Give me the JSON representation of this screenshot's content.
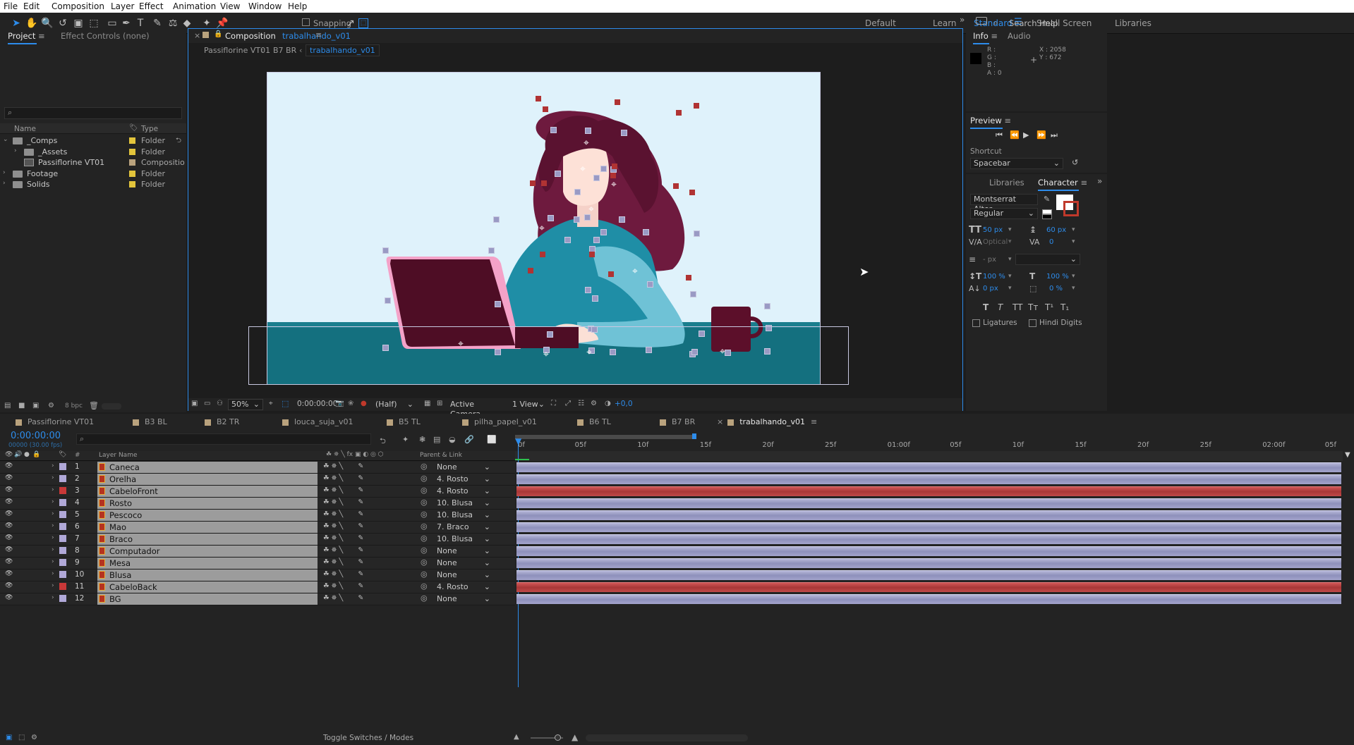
{
  "menu": [
    "File",
    "Edit",
    "Composition",
    "Layer",
    "Effect",
    "Animation",
    "View",
    "Window",
    "Help"
  ],
  "toolbar": {
    "snapping": "Snapping",
    "workspaces": [
      "Default",
      "Learn",
      "Standard",
      "Small Screen",
      "Libraries"
    ],
    "active_workspace": "Standard",
    "search_placeholder": "Search Help"
  },
  "project": {
    "tab": "Project",
    "effect_controls": "Effect Controls (none)",
    "search_placeholder": "",
    "col_name": "Name",
    "col_type": "Type",
    "items": [
      {
        "name": "_Comps",
        "type": "Folder",
        "indent": 0,
        "expanded": true,
        "kind": "folder"
      },
      {
        "name": "_Assets",
        "type": "Folder",
        "indent": 1,
        "expanded": false,
        "kind": "folder"
      },
      {
        "name": "Passiflorine VT01",
        "type": "Compositio",
        "indent": 1,
        "expanded": null,
        "kind": "comp"
      },
      {
        "name": "Footage",
        "type": "Folder",
        "indent": 0,
        "expanded": false,
        "kind": "folder"
      },
      {
        "name": "Solids",
        "type": "Folder",
        "indent": 0,
        "expanded": false,
        "kind": "folder"
      }
    ],
    "bpc": "8 bpc"
  },
  "comp": {
    "tab_prefix": "Composition",
    "tab_name": "trabalhando_v01",
    "breadcrumbs": [
      "Passiflorine VT01",
      "B7 BR",
      "trabalhando_v01"
    ],
    "zoom": "50%",
    "timecode": "0:00:00:00",
    "resolution": "(Half)",
    "camera": "Active Camera",
    "view": "1 View",
    "exposure": "+0,0"
  },
  "info": {
    "tab": "Info",
    "audio_tab": "Audio",
    "r": "R :",
    "g": "G :",
    "b": "B :",
    "a": "A : 0",
    "x": "X : 2058",
    "y": "Y : 672"
  },
  "preview": {
    "title": "Preview",
    "shortcut_label": "Shortcut",
    "shortcut_value": "Spacebar"
  },
  "character": {
    "libraries_tab": "Libraries",
    "tab": "Character",
    "font": "Montserrat Alter...",
    "style": "Regular",
    "size": "50 px",
    "leading": "60 px",
    "kerning": "Optical",
    "tracking": "0",
    "stroke": "- px",
    "vscale": "100 %",
    "hscale": "100 %",
    "baseline": "0 px",
    "tsume": "0 %",
    "ligatures": "Ligatures",
    "hindi": "Hindi Digits"
  },
  "timeline": {
    "tabs": [
      "Passiflorine VT01",
      "B3 BL",
      "B2 TR",
      "louca_suja_v01",
      "B5 TL",
      "pilha_papel_v01",
      "B6 TL",
      "B7 BR",
      "trabalhando_v01"
    ],
    "active_tab": "trabalhando_v01",
    "timecode": "0:00:00:00",
    "fps": "00000 (30.00 fps)",
    "col_layer": "Layer Name",
    "col_parent": "Parent & Link",
    "toggle": "Toggle Switches / Modes",
    "ruler": [
      "0f",
      "05f",
      "10f",
      "15f",
      "20f",
      "25f",
      "01:00f",
      "05f",
      "10f",
      "15f",
      "20f",
      "25f",
      "02:00f",
      "05f"
    ],
    "layers": [
      {
        "n": "1",
        "name": "Caneca",
        "parent": "None",
        "color": "#b0a8d8",
        "bar": "blue"
      },
      {
        "n": "2",
        "name": "Orelha",
        "parent": "4. Rosto",
        "color": "#b0a8d8",
        "bar": "blue"
      },
      {
        "n": "3",
        "name": "CabeloFront",
        "parent": "4. Rosto",
        "color": "#c83838",
        "bar": "red"
      },
      {
        "n": "4",
        "name": "Rosto",
        "parent": "10. Blusa",
        "color": "#b0a8d8",
        "bar": "blue"
      },
      {
        "n": "5",
        "name": "Pescoco",
        "parent": "10. Blusa",
        "color": "#b0a8d8",
        "bar": "blue"
      },
      {
        "n": "6",
        "name": "Mao",
        "parent": "7. Braco",
        "color": "#b0a8d8",
        "bar": "blue"
      },
      {
        "n": "7",
        "name": "Braco",
        "parent": "10. Blusa",
        "color": "#b0a8d8",
        "bar": "blue"
      },
      {
        "n": "8",
        "name": "Computador",
        "parent": "None",
        "color": "#b0a8d8",
        "bar": "blue"
      },
      {
        "n": "9",
        "name": "Mesa",
        "parent": "None",
        "color": "#b0a8d8",
        "bar": "blue"
      },
      {
        "n": "10",
        "name": "Blusa",
        "parent": "None",
        "color": "#b0a8d8",
        "bar": "blue"
      },
      {
        "n": "11",
        "name": "CabeloBack",
        "parent": "4. Rosto",
        "color": "#c83838",
        "bar": "red"
      },
      {
        "n": "12",
        "name": "BG",
        "parent": "None",
        "color": "#b0a8d8",
        "bar": "blue"
      }
    ]
  }
}
